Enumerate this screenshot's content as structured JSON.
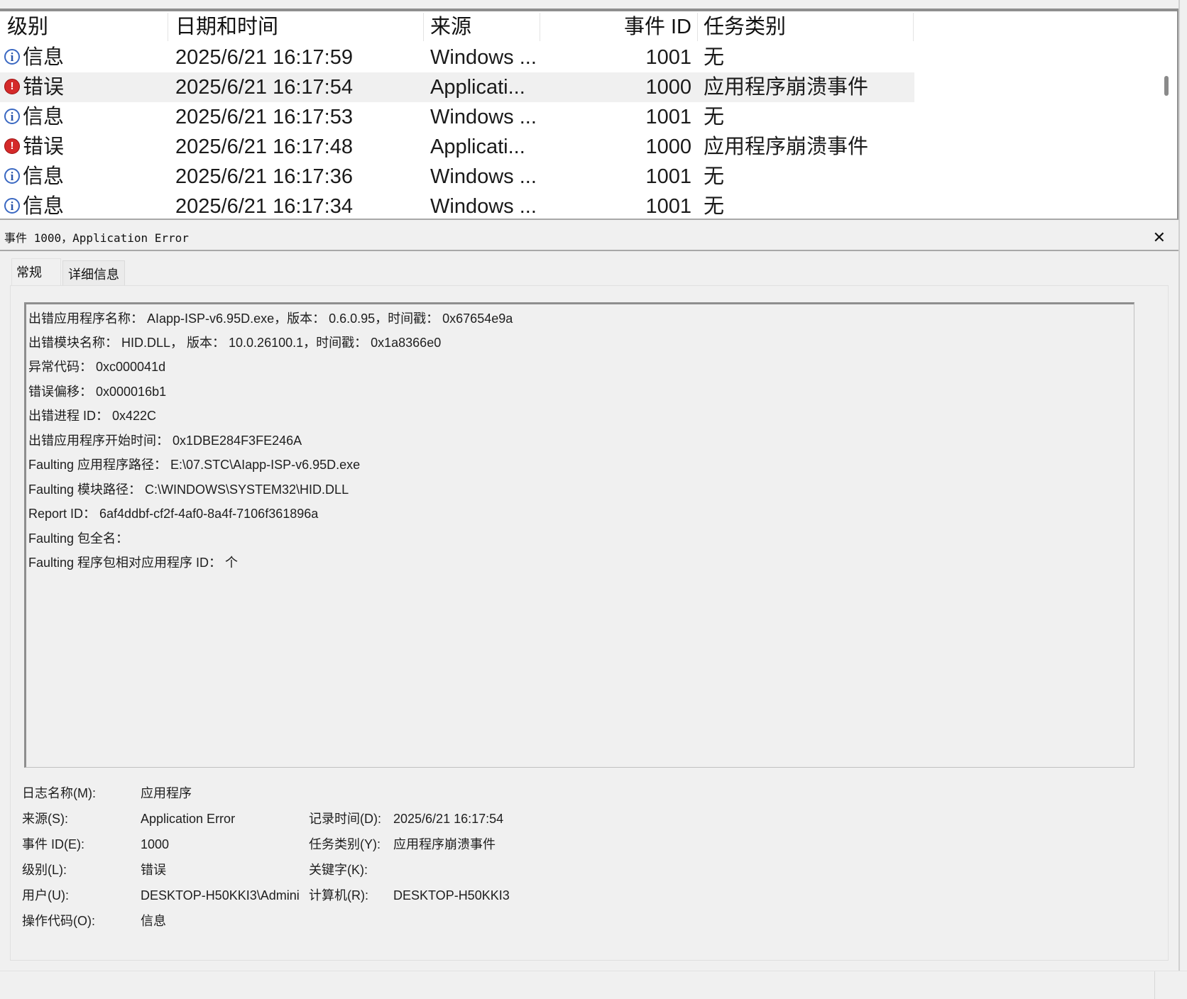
{
  "list": {
    "columns": {
      "level": "级别",
      "datetime": "日期和时间",
      "source": "来源",
      "event_id": "事件 ID",
      "task": "任务类别"
    },
    "rows": [
      {
        "icon": "info-icon",
        "level": "信息",
        "datetime": "2025/6/21 16:17:59",
        "source": "Windows ...",
        "event_id": "1001",
        "task": "无"
      },
      {
        "icon": "error-icon",
        "level": "错误",
        "datetime": "2025/6/21 16:17:54",
        "source": "Applicati...",
        "event_id": "1000",
        "task": "应用程序崩溃事件",
        "selected": true
      },
      {
        "icon": "info-icon",
        "level": "信息",
        "datetime": "2025/6/21 16:17:53",
        "source": "Windows ...",
        "event_id": "1001",
        "task": "无"
      },
      {
        "icon": "error-icon",
        "level": "错误",
        "datetime": "2025/6/21 16:17:48",
        "source": "Applicati...",
        "event_id": "1000",
        "task": "应用程序崩溃事件"
      },
      {
        "icon": "info-icon",
        "level": "信息",
        "datetime": "2025/6/21 16:17:36",
        "source": "Windows ...",
        "event_id": "1001",
        "task": "无"
      },
      {
        "icon": "info-icon",
        "level": "信息",
        "datetime": "2025/6/21 16:17:34",
        "source": "Windows ...",
        "event_id": "1001",
        "task": "无"
      }
    ]
  },
  "detail": {
    "title": "事件 1000，Application Error",
    "close_icon": "✕",
    "tabs": [
      "常规",
      "详细信息"
    ],
    "description_lines": [
      "出错应用程序名称： AIapp-ISP-v6.95D.exe，版本： 0.6.0.95，时间戳： 0x67654e9a",
      "出错模块名称： HID.DLL， 版本： 10.0.26100.1，时间戳： 0x1a8366e0",
      "异常代码： 0xc000041d",
      "错误偏移： 0x000016b1",
      "出错进程 ID： 0x422C",
      "出错应用程序开始时间： 0x1DBE284F3FE246A",
      "Faulting 应用程序路径： E:\\07.STC\\AIapp-ISP-v6.95D.exe",
      "Faulting 模块路径： C:\\WINDOWS\\SYSTEM32\\HID.DLL",
      "Report ID： 6af4ddbf-cf2f-4af0-8a4f-7106f361896a",
      "Faulting 包全名：",
      "Faulting 程序包相对应用程序 ID： 个"
    ],
    "properties": {
      "log_name_label": "日志名称(M):",
      "log_name": "应用程序",
      "source_label": "来源(S):",
      "source": "Application Error",
      "logged_label": "记录时间(D):",
      "logged": "2025/6/21 16:17:54",
      "event_id_label": "事件 ID(E):",
      "event_id": "1000",
      "task_label": "任务类别(Y):",
      "task": "应用程序崩溃事件",
      "level_label": "级别(L):",
      "level": "错误",
      "keywords_label": "关键字(K):",
      "keywords": "",
      "user_label": "用户(U):",
      "user": "DESKTOP-H50KKI3\\Admini",
      "computer_label": "计算机(R):",
      "computer": "DESKTOP-H50KKI3",
      "opcode_label": "操作代码(O):",
      "opcode": "信息"
    }
  }
}
